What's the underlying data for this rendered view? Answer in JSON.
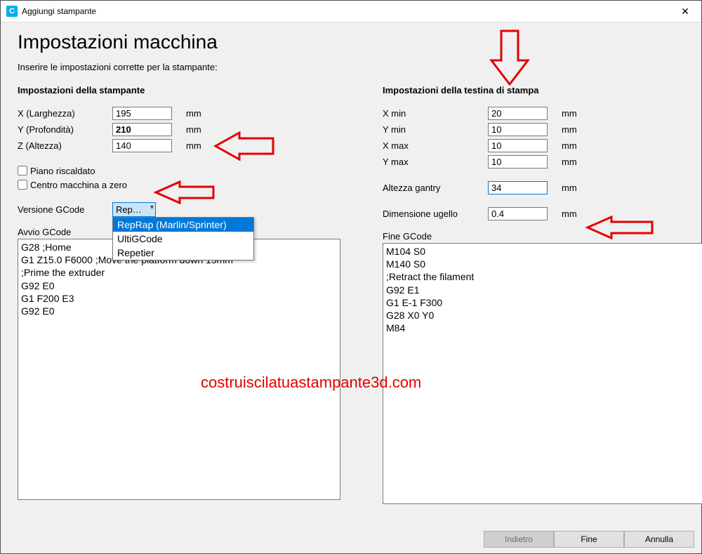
{
  "window": {
    "title": "Aggiungi stampante",
    "icon_text": "C"
  },
  "header": {
    "title": "Impostazioni macchina",
    "subtitle": "Inserire le impostazioni corrette per la stampante:"
  },
  "printer": {
    "section": "Impostazioni della stampante",
    "x_label": "X (Larghezza)",
    "x_value": "195",
    "y_label": "Y (Profondità)",
    "y_value": "210",
    "z_label": "Z (Altezza)",
    "z_value": "140",
    "unit": "mm",
    "heated_bed": "Piano riscaldato",
    "center_zero": "Centro macchina a zero",
    "gcode_version_label": "Versione GCode",
    "gcode_version_value": "Rep…",
    "gcode_options": {
      "o1": "RepRap (Marlin/Sprinter)",
      "o2": "UltiGCode",
      "o3": "Repetier"
    },
    "start_label": "Avvio GCode",
    "start_code": "G28 ;Home\nG1 Z15.0 F6000 ;Move the platform down 15mm\n;Prime the extruder\nG92 E0\nG1 F200 E3\nG92 E0"
  },
  "head": {
    "section": "Impostazioni della testina di stampa",
    "xmin_label": "X min",
    "xmin_value": "20",
    "ymin_label": "Y min",
    "ymin_value": "10",
    "xmax_label": "X max",
    "xmax_value": "10",
    "ymax_label": "Y max",
    "ymax_value": "10",
    "gantry_label": "Altezza gantry",
    "gantry_value": "34",
    "nozzle_label": "Dimensione ugello",
    "nozzle_value": "0.4",
    "unit": "mm",
    "end_label": "Fine GCode",
    "end_code": "M104 S0\nM140 S0\n;Retract the filament\nG92 E1\nG1 E-1 F300\nG28 X0 Y0\nM84"
  },
  "buttons": {
    "back": "Indietro",
    "finish": "Fine",
    "cancel": "Annulla"
  },
  "watermark": "costruiscilatuastampante3d.com"
}
